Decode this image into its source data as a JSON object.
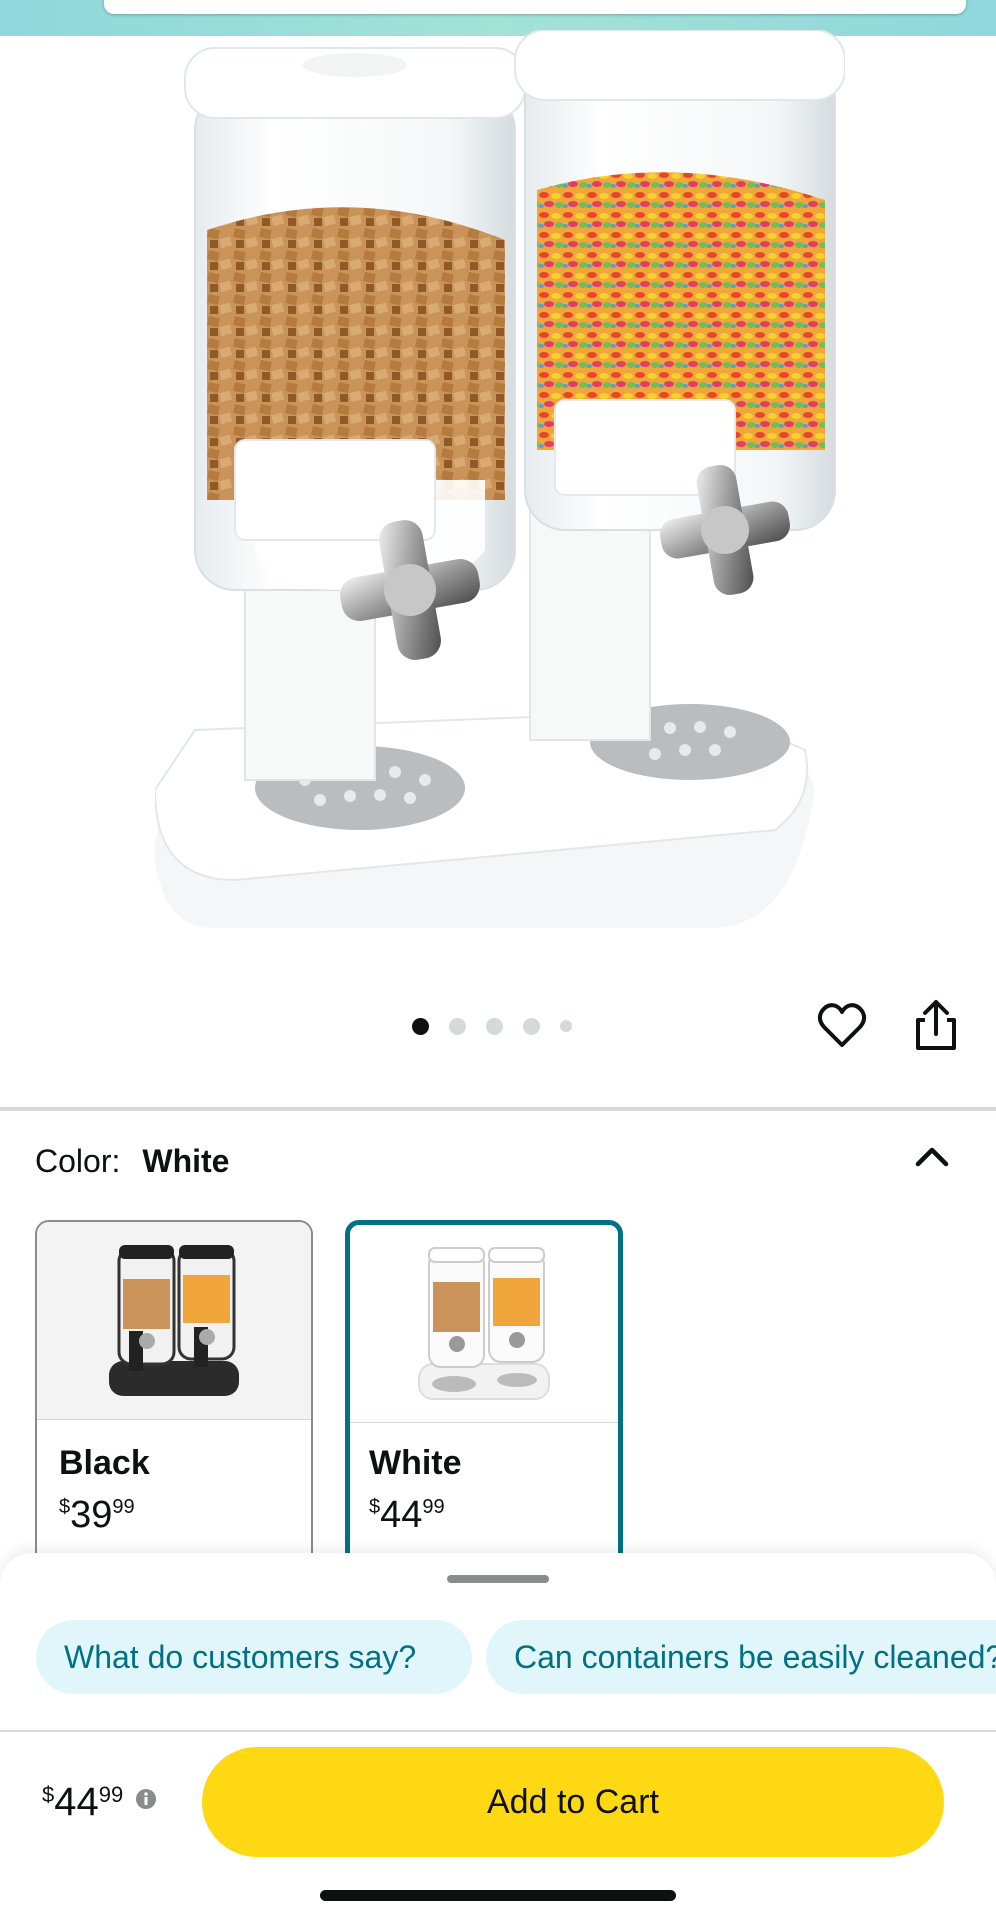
{
  "product": {
    "image_alt": "Double cereal dispenser with two transparent containers, white base and chrome dispensing knobs"
  },
  "gallery": {
    "image_count": 5,
    "active_index": 0
  },
  "actions": {
    "wishlist_icon": "heart-icon",
    "share_icon": "share-icon"
  },
  "color": {
    "label": "Color:",
    "selected": "White",
    "options": [
      {
        "name": "Black",
        "price_symbol": "$",
        "price_whole": "39",
        "price_cents": "99",
        "selected": false
      },
      {
        "name": "White",
        "price_symbol": "$",
        "price_whole": "44",
        "price_cents": "99",
        "selected": true
      }
    ]
  },
  "sheet": {
    "chips": [
      "What do customers say?",
      "Can containers be easily cleaned?"
    ],
    "price_symbol": "$",
    "price_whole": "44",
    "price_cents": "99",
    "add_to_cart": "Add to Cart"
  },
  "colors": {
    "accent": "#007185",
    "cart_button": "#ffd814",
    "chip_bg": "#e1f6fa"
  }
}
